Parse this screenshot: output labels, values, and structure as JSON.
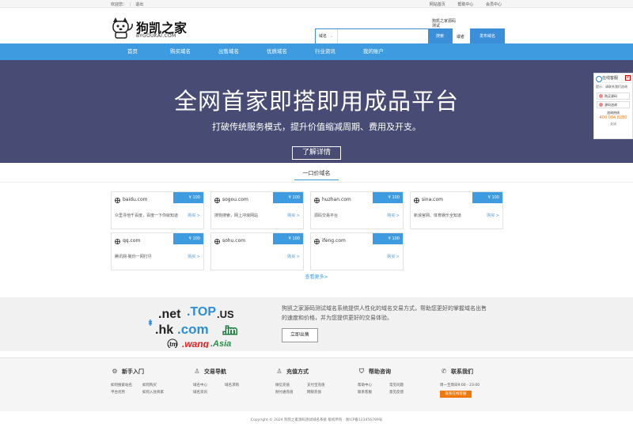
{
  "topbar": {
    "welcome": "欢迎您：",
    "logout": "退出",
    "links": [
      "网站首页",
      "帮助中心",
      "会员中心"
    ]
  },
  "logo": {
    "name": "狗凯之家",
    "domain": "BYGOUKAI.COM"
  },
  "search": {
    "type": "域名",
    "placeholder": "",
    "button": "搜索"
  },
  "hot_text": "狗凯之家源码测试",
  "or": "或者",
  "post_button": "发布域名",
  "nav": [
    "首页",
    "购买域名",
    "出售域名",
    "优质域名",
    "行业资讯",
    "我的账户"
  ],
  "hero": {
    "title": "全网首家即搭即用成品平台",
    "subtitle": "打破传统服务模式，提升价值缩减周期、费用及开支。",
    "button": "了解详情"
  },
  "section_title": "一口价域名",
  "domains": [
    {
      "name": "baidu.com",
      "price": "¥ 100",
      "desc": "众里寻他千百度，百度一下你就知道",
      "buy": "购买 >"
    },
    {
      "name": "sogou.com",
      "price": "¥ 100",
      "desc": "搜狗搜索，网上冲浪网站",
      "buy": "购买 >"
    },
    {
      "name": "huzhan.com",
      "price": "¥ 100",
      "desc": "源码交易平台",
      "buy": "购买 >"
    },
    {
      "name": "sina.com",
      "price": "¥ 100",
      "desc": "新浪官网、体育娱乐全知道",
      "buy": "购买 >"
    },
    {
      "name": "qq.com",
      "price": "¥ 100",
      "desc": "腾讯网-致你一网打尽",
      "buy": "购买 >"
    },
    {
      "name": "sohu.com",
      "price": "¥ 100",
      "desc": "",
      "buy": "购买 >"
    },
    {
      "name": "ifeng.com",
      "price": "¥ 100",
      "desc": "",
      "buy": "购买 >"
    }
  ],
  "see_more": "查看更多>",
  "promo": {
    "tlds": [
      ".net",
      ".TOP",
      ".US",
      ".hk",
      ".com",
      ".im",
      ".tm",
      ".wang",
      ".Asia"
    ],
    "text": "狗凯之家源码测试域名系统提供人性化的域名交易方式，帮助您更好的掌握域名出售的速度和价格，并为您提供更好的交易体验。",
    "button": "立即出售"
  },
  "footer": {
    "cols": [
      {
        "title": "新手入门",
        "icon": "gear-icon",
        "links": [
          "如何搜索站名",
          "如何购买",
          "平台优势",
          "如何入驻商家"
        ]
      },
      {
        "title": "交易导航",
        "icon": "person-icon",
        "links": [
          "域名中心",
          "域名求购",
          "域名资讯"
        ]
      },
      {
        "title": "充值方式",
        "icon": "person-icon",
        "links": [
          "微信充值",
          "支付宝充值",
          "财付通充值",
          "网银充值"
        ]
      },
      {
        "title": "帮助咨询",
        "icon": "shield-icon",
        "links": [
          "帮助中心",
          "常见问题",
          "联系客服",
          "意见反馈"
        ]
      },
      {
        "title": "联系我们",
        "icon": "phone-icon",
        "hours": "周一至周日9:00 - 23:00",
        "button": "联系在线客服"
      }
    ],
    "copyright": "Copyright © 2024 狗凯之家源码测试域名系统 版权所有 · 浙ICP备123456789号"
  },
  "float": {
    "title": "在线客服",
    "tip": "提示：请联系我们咨询",
    "btn1": "购买源码",
    "btn2": "源码咨询",
    "label": "咨询热线",
    "phone": "400 004 8280",
    "close": "关闭"
  }
}
